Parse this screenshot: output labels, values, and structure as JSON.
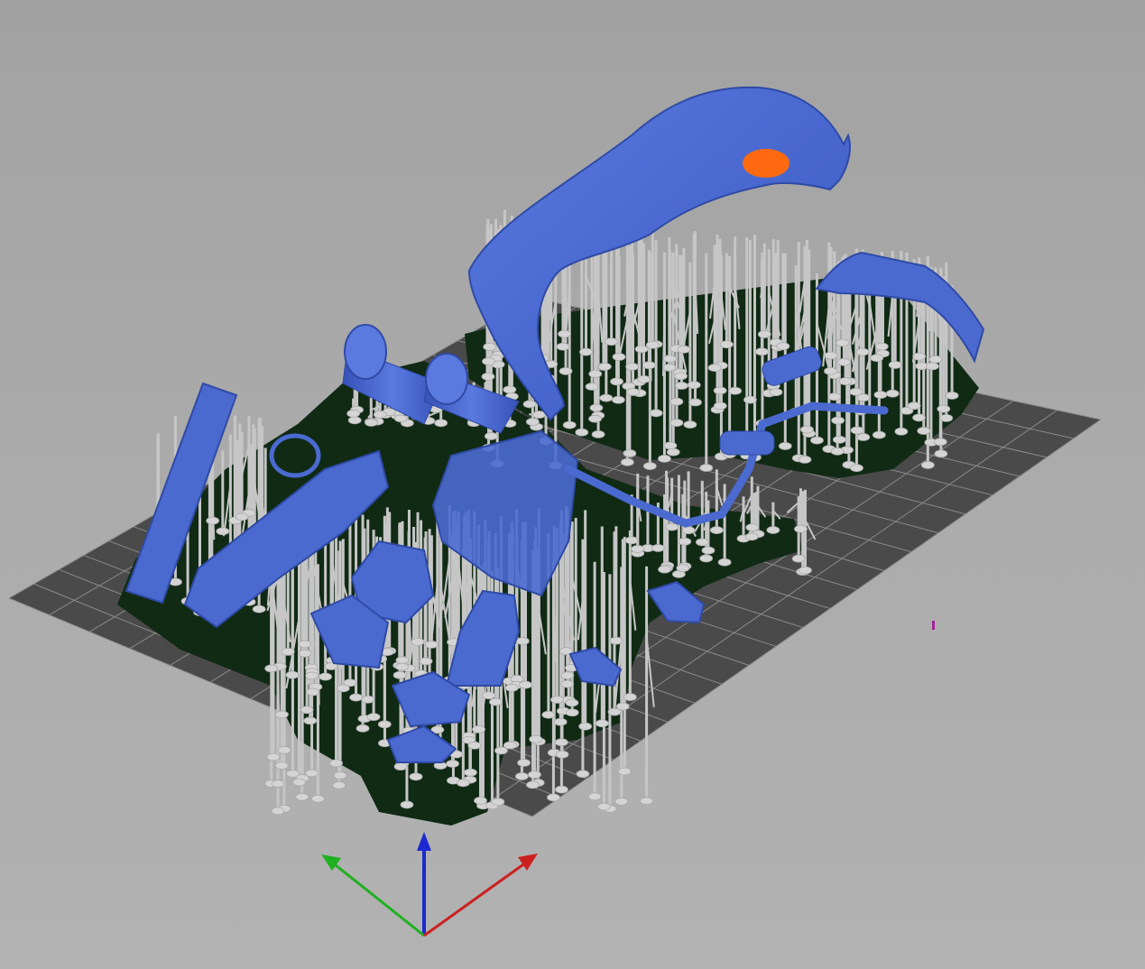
{
  "viewport": {
    "background_color": "#aaaaaa",
    "bed_color": "#4a4a4a",
    "bed_grid_color": "#8c8c8c",
    "model_color": "#4a6ad0",
    "model_shadow_color": "#2f4aa6",
    "support_color": "#c4c4c4",
    "support_pad_color": "#d6d6d6",
    "raft_color": "#0f2a12",
    "selected_face_color": "#ff6a10",
    "marker_color": "#a3239b"
  },
  "axes": {
    "x_axis_color": "#cc2020",
    "y_axis_color": "#20b020",
    "z_axis_color": "#1a2ad0",
    "x_icon": "arrow-x-red-icon",
    "y_icon": "arrow-y-green-icon",
    "z_icon": "arrow-z-blue-icon"
  },
  "scene": {
    "objects": [
      "fender-large",
      "fender-small",
      "fuel-tank-left",
      "fuel-tank-right",
      "dashboard",
      "steering-wheel",
      "side-panel",
      "door-frame",
      "exhaust-pipe",
      "seat-left",
      "seat-right",
      "seat-base",
      "small-part-a",
      "small-part-b"
    ]
  }
}
